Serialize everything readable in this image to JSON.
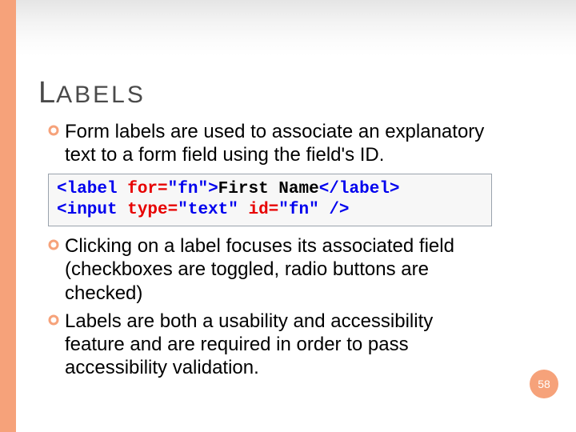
{
  "title_first_letter": "L",
  "title_rest": "ABELS",
  "bullets": {
    "b1": "Form labels are used to associate an explanatory text to a form field using the field's ID.",
    "b2": "Clicking on a label focuses its associated field (checkboxes are toggled, radio buttons are checked)",
    "b3": "Labels are both a usability and accessibility feature and are required in order to pass accessibility validation."
  },
  "code": {
    "l1_open": "<label",
    "l1_attr": " for=",
    "l1_val": "\"fn\"",
    "l1_close": ">",
    "l1_text": "First Name",
    "l1_end": "</label>",
    "l2_open": "<input",
    "l2_attr1": " type=",
    "l2_val1": "\"text\"",
    "l2_attr2": " id=",
    "l2_val2": "\"fn\"",
    "l2_end": " />"
  },
  "page_number": "58"
}
